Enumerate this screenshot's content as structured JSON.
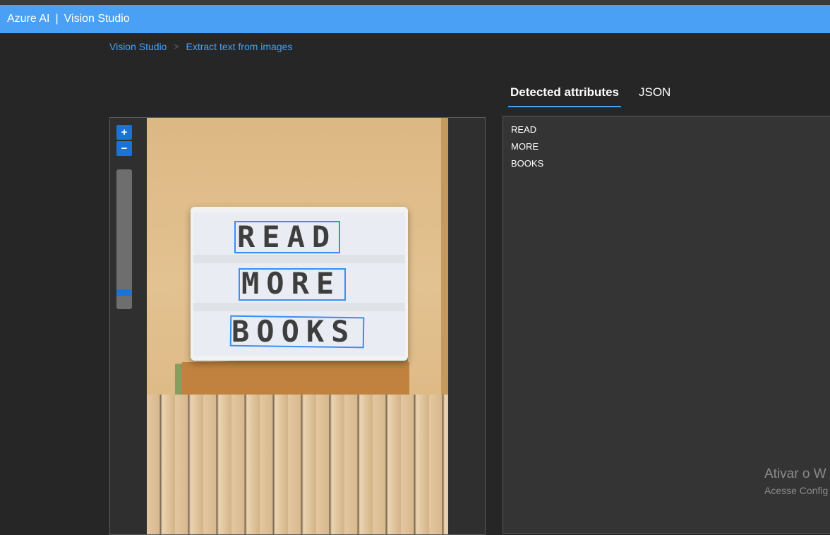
{
  "header": {
    "brand": "Azure AI",
    "separator": "|",
    "product": "Vision Studio"
  },
  "breadcrumb": {
    "items": [
      "Vision Studio",
      "Extract text from images"
    ],
    "separator": ">"
  },
  "tabs": [
    {
      "label": "Detected attributes",
      "active": true
    },
    {
      "label": "JSON",
      "active": false
    }
  ],
  "zoom": {
    "in_label": "+",
    "out_label": "−",
    "level": 0.06
  },
  "image": {
    "sign_lines": [
      "READ",
      "MORE",
      "BOOKS"
    ]
  },
  "results": {
    "lines": [
      "READ",
      "MORE",
      "BOOKS"
    ]
  },
  "watermark": {
    "line1": "Ativar o W",
    "line2": "Acesse Config"
  },
  "colors": {
    "header_bg": "#4aa0f5",
    "accent": "#1a73d6",
    "bbox": "#3d8ef0",
    "page_bg": "#262626",
    "panel_bg": "#343434"
  }
}
